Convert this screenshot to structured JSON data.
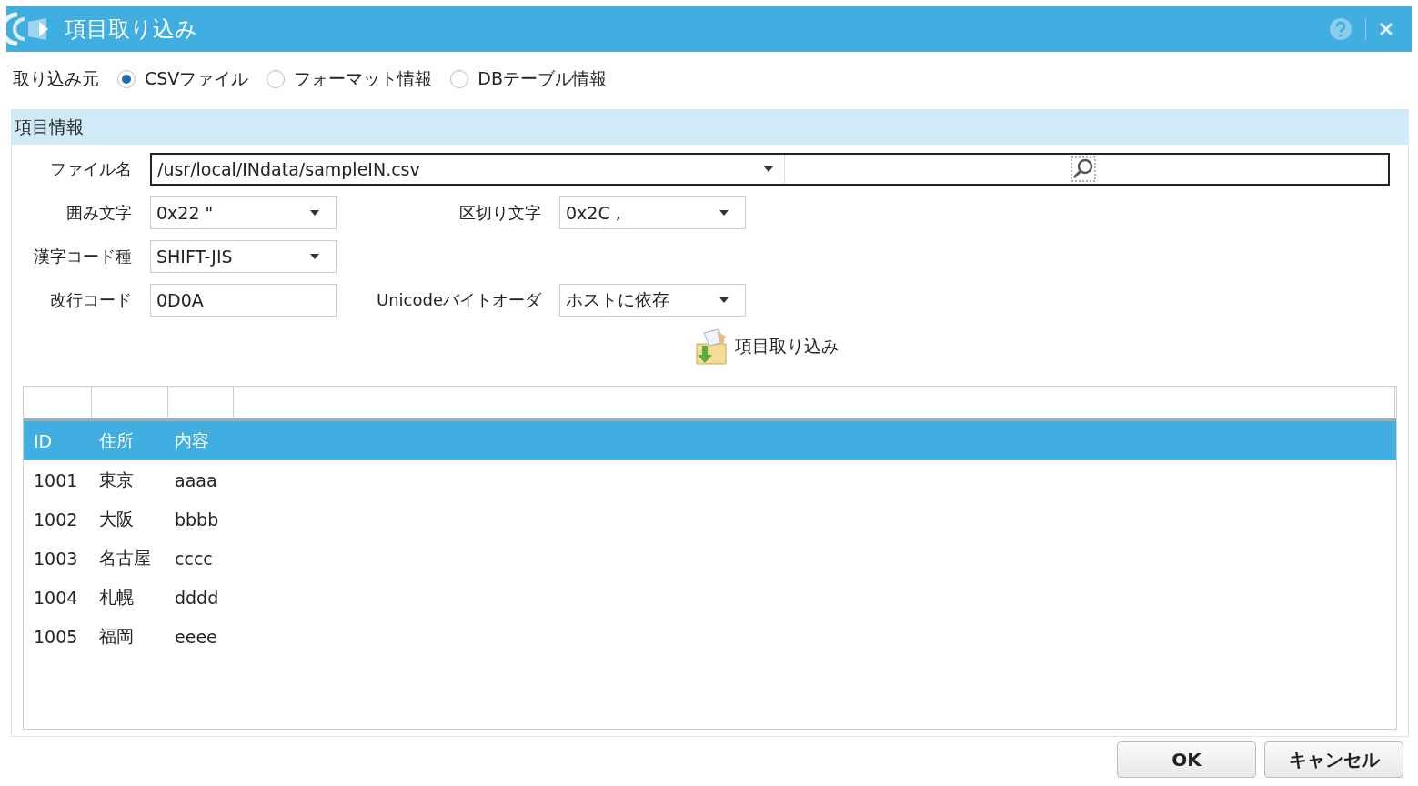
{
  "window": {
    "title": "項目取り込み"
  },
  "source": {
    "label": "取り込み元",
    "options": [
      {
        "label": "CSVファイル",
        "selected": true
      },
      {
        "label": "フォーマット情報",
        "selected": false
      },
      {
        "label": "DBテーブル情報",
        "selected": false
      }
    ]
  },
  "section": {
    "title": "項目情報",
    "field_rows": [
      [
        {
          "label": "ファイル名",
          "kind": "file",
          "value": "/usr/local/INdata/sampleIN.csv"
        }
      ],
      [
        {
          "label": "囲み文字",
          "kind": "combo",
          "value": "0x22 \""
        },
        {
          "label": "区切り文字",
          "kind": "combo",
          "value": "0x2C ,"
        }
      ],
      [
        {
          "label": "漢字コード種",
          "kind": "combo",
          "value": "SHIFT-JIS"
        }
      ],
      [
        {
          "label": "改行コード",
          "kind": "text",
          "value": "0D0A"
        },
        {
          "label": "Unicodeバイトオーダ",
          "kind": "combo",
          "value": "ホストに依存"
        }
      ]
    ],
    "import_button": "項目取り込み",
    "table": {
      "columns": [
        "ID",
        "住所",
        "内容"
      ],
      "rows": [
        [
          "1001",
          "東京",
          "aaaa"
        ],
        [
          "1002",
          "大阪",
          "bbbb"
        ],
        [
          "1003",
          "名古屋",
          "cccc"
        ],
        [
          "1004",
          "札幌",
          "dddd"
        ],
        [
          "1005",
          "福岡",
          "eeee"
        ]
      ]
    }
  },
  "buttons": [
    "OK",
    "キャンセル"
  ]
}
